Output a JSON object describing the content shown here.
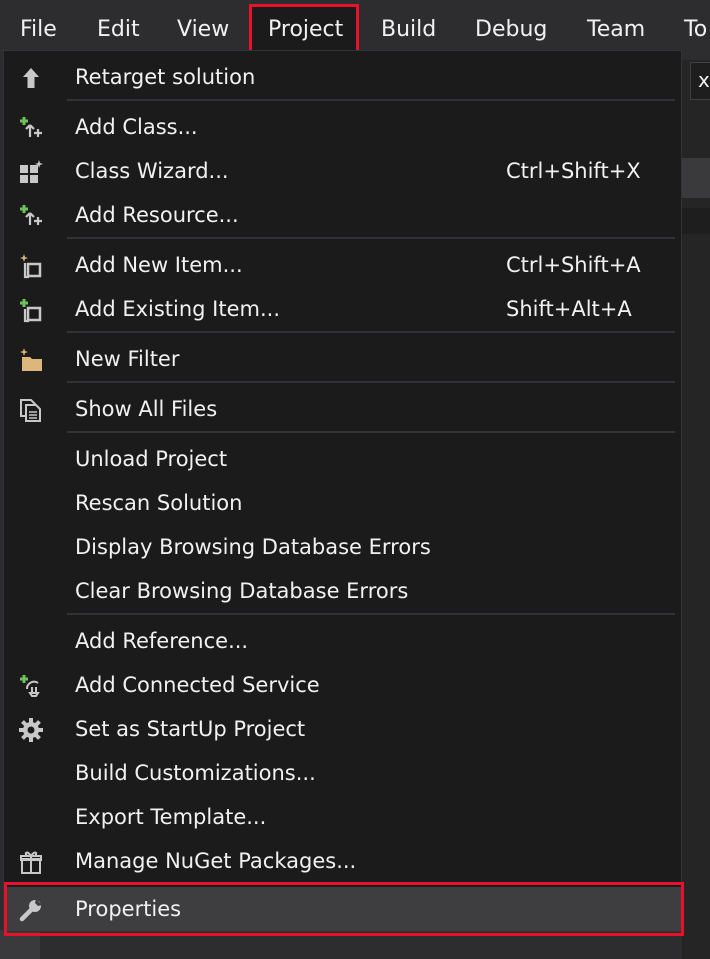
{
  "menubar": {
    "items": [
      "File",
      "Edit",
      "View",
      "Project",
      "Build",
      "Debug",
      "Team",
      "To"
    ]
  },
  "background": {
    "partial_text": "x"
  },
  "menu": {
    "items": [
      {
        "label": "Retarget solution",
        "shortcut": "",
        "icon": "arrow-up-icon"
      },
      {
        "label": "Add Class...",
        "shortcut": "",
        "icon": "add-class-icon"
      },
      {
        "label": "Class Wizard...",
        "shortcut": "Ctrl+Shift+X",
        "icon": "class-wizard-icon"
      },
      {
        "label": "Add Resource...",
        "shortcut": "",
        "icon": "add-resource-icon"
      },
      {
        "label": "Add New Item...",
        "shortcut": "Ctrl+Shift+A",
        "icon": "add-new-item-icon"
      },
      {
        "label": "Add Existing Item...",
        "shortcut": "Shift+Alt+A",
        "icon": "add-existing-item-icon"
      },
      {
        "label": "New Filter",
        "shortcut": "",
        "icon": "new-filter-icon"
      },
      {
        "label": "Show All Files",
        "shortcut": "",
        "icon": "show-all-files-icon"
      },
      {
        "label": "Unload Project",
        "shortcut": "",
        "icon": ""
      },
      {
        "label": "Rescan Solution",
        "shortcut": "",
        "icon": ""
      },
      {
        "label": "Display Browsing Database Errors",
        "shortcut": "",
        "icon": ""
      },
      {
        "label": "Clear Browsing Database Errors",
        "shortcut": "",
        "icon": ""
      },
      {
        "label": "Add Reference...",
        "shortcut": "",
        "icon": ""
      },
      {
        "label": "Add Connected Service",
        "shortcut": "",
        "icon": "connected-service-icon"
      },
      {
        "label": "Set as StartUp Project",
        "shortcut": "",
        "icon": "gear-icon"
      },
      {
        "label": "Build Customizations...",
        "shortcut": "",
        "icon": ""
      },
      {
        "label": "Export Template...",
        "shortcut": "",
        "icon": ""
      },
      {
        "label": "Manage NuGet Packages...",
        "shortcut": "",
        "icon": "nuget-package-icon"
      },
      {
        "label": "Properties",
        "shortcut": "",
        "icon": "wrench-icon"
      }
    ]
  },
  "colors": {
    "menu_background": "#1b1b1c",
    "menubar_background": "#2d2d30",
    "highlight_border": "#e8112d",
    "selected_background": "#3e3e40",
    "text": "#f1f1f1",
    "icon_green": "#6ec25a",
    "icon_gray": "#c8c8c8",
    "icon_folder": "#dcb67a"
  }
}
